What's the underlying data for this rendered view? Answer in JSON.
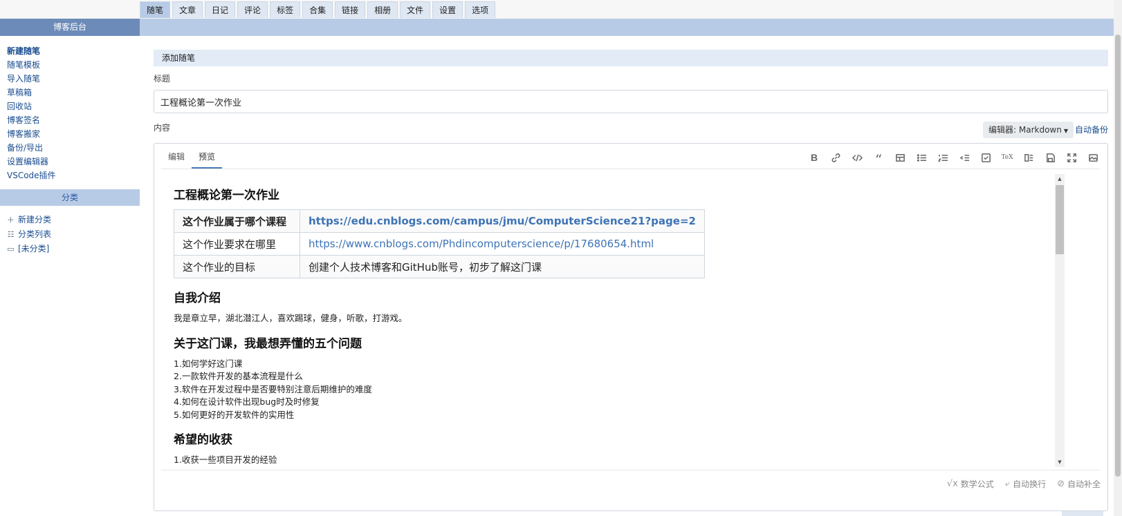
{
  "top_tabs": [
    "随笔",
    "文章",
    "日记",
    "评论",
    "标签",
    "合集",
    "链接",
    "相册",
    "文件",
    "设置",
    "选项"
  ],
  "sidebar": {
    "title": "博客后台",
    "items": [
      "新建随笔",
      "随笔模板",
      "导入随笔",
      "草稿箱",
      "回收站",
      "博客签名",
      "博客搬家",
      "备份/导出",
      "设置编辑器",
      "VSCode插件"
    ],
    "category_title": "分类",
    "category_items": [
      "新建分类",
      "分类列表",
      "[未分类]"
    ]
  },
  "main": {
    "section_title": "添加随笔",
    "title_label": "标题",
    "title_value": "工程概论第一次作业",
    "content_label": "内容",
    "editor_select": "编辑器: Markdown",
    "auto_backup": "自动备份",
    "editor_tabs": [
      "编辑",
      "预览"
    ],
    "toolbar_icons": [
      "bold-icon",
      "link-icon",
      "code-icon",
      "quote-icon",
      "table-icon",
      "bullet-list-icon",
      "numbered-list-icon",
      "outdent-icon",
      "checkbox-icon",
      "tex-icon",
      "toc-icon",
      "save-icon",
      "fullscreen-icon",
      "image-icon"
    ],
    "status": [
      "数学公式",
      "自动换行",
      "自动补全"
    ]
  },
  "preview": {
    "heading": "工程概论第一次作业",
    "table": [
      [
        "这个作业属于哪个课程",
        "https://edu.cnblogs.com/campus/jmu/ComputerScience21?page=2"
      ],
      [
        "这个作业要求在哪里",
        "https://www.cnblogs.com/Phdincomputerscience/p/17680654.html"
      ],
      [
        "这个作业的目标",
        "创建个人技术博客和GitHub账号，初步了解这门课"
      ]
    ],
    "intro_heading": "自我介绍",
    "intro_text": "我是章立早，湖北潜江人，喜欢踢球，健身，听歌，打游戏。",
    "questions_heading": "关于这门课，我最想弄懂的五个问题",
    "questions": [
      "1.如何学好这门课",
      "2.一款软件开发的基本流程是什么",
      "3.软件在开发过程中是否要特别注意后期维护的难度",
      "4.如何在设计软件出现bug时及时修复",
      "5.如何更好的开发软件的实用性"
    ],
    "harvest_heading": "希望的收获",
    "harvest_first": "1.收获一些项目开发的经验"
  }
}
